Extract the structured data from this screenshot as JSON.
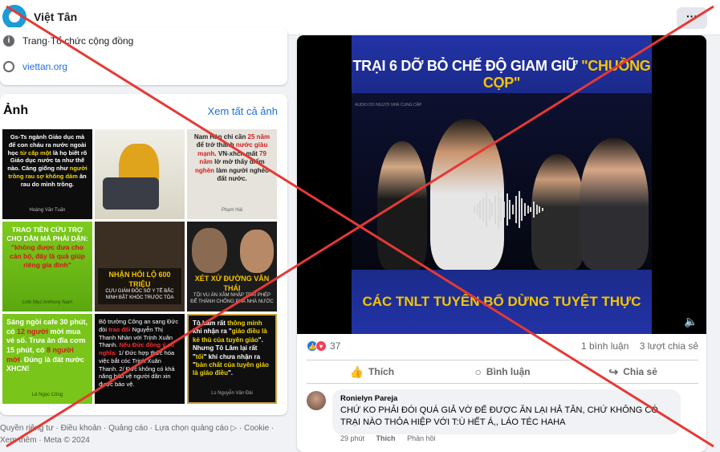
{
  "header": {
    "brand": "Việt Tân",
    "more_label": "···"
  },
  "intro": {
    "category_prefix": "Trang",
    "category_sep": " · ",
    "category": "Tổ chức cộng đồng",
    "website": "viettan.org",
    "info_icon": "info-icon",
    "globe_icon": "globe-icon"
  },
  "photos": {
    "title": "Ảnh",
    "see_all": "Xem tất cả ảnh",
    "tiles": {
      "t1": {
        "a": "Gs-Ts ngành Giáo dục mà để con cháu ra nước ngoài học ",
        "b": "từ cấp một",
        "c": " là họ biết rõ Giáo dục nước ta như thế nào. Càng giống như ",
        "d": "người trồng rau sợ không dám",
        "e": " ăn rau do mình trồng.",
        "sig": "Hoàng Văn Tuấn"
      },
      "t3": {
        "a": "Nam Hàn chỉ cần ",
        "b": "25 năm",
        "c": " để trở thành ",
        "d": "nước giàu mạnh",
        "e": ". VN-xhcn mất ",
        "f": "79 năm",
        " g": "",
        "h": " lờ mờ thấy điểm ",
        "i": "nghèn",
        "j": " làm người nghèo đất nước.",
        "sig": "Phạm Hải"
      },
      "t4": {
        "a": "TRAO TIỀN CỨU TRỢ CHO DÂN MÀ PHẢI DẶN: ",
        "b": "\"không được đưa cho cán bộ, đây là quà giúp riêng gia đình\"",
        "sig": "Linh Mục Anthony Nam"
      },
      "t5": {
        "a": "NHẬN HỐI LỘ 600 TRIỆU",
        "b": "CỰU GIÁM ĐỐC SỞ Y TẾ BẮC NINH BẬT KHÓC TRƯỚC TÒA"
      },
      "t6": {
        "a": "XÉT XỬ ĐƯỜNG VĂN THÁI",
        "b": "TỘI VU ÁN XÂM NHẬP TRÁI PHÉP ĐỂ THÀNH CHỐNG PHÁ NHÀ NƯỚC"
      },
      "t7": {
        "a": "Sáng ngồi cafe 30 phút, có ",
        "b": "12 người",
        "c": " mời mua vé số. Trưa ăn đĩa cơm 15 phút, có ",
        "d": "8 người mời",
        "e": ". Đúng là đất nước XHCN!",
        "sig": "Lê Ngọc Công"
      },
      "t8": {
        "a": "Bộ trưởng Công an sang Đức đòi ",
        "b": "trao đổi",
        "c": " Nguyễn Thị Thanh Nhàn với Trịnh Xuân Thanh. ",
        "d": "Nếu Đức đồng ý có nghĩa:",
        "e": " 1/ Đức hợp thức hóa việc bắt cóc Trịnh Xuân Thanh. 2/ Đức không có khả năng bảo vệ người dân xin được bảo vệ."
      },
      "t9": {
        "a": "Tô Lâm rất ",
        "b": "thông minh",
        "c": " khi nhận ra \"",
        "d": "giáo điều là kẻ thù của tuyên giáo",
        "e": "\". Nhưng Tô Lâm lại rất \"",
        "f": "tối",
        "g": "\" khi chưa nhận ra \"",
        "h": "bản chất của tuyên giáo là giáo điều",
        "i": "\".",
        "sig": "Ls Nguyễn Văn Đài"
      }
    }
  },
  "footer": {
    "text": "Quyền riêng tư · Điều khoản · Quảng cáo · Lựa chọn quảng cáo ▷ · Cookie · Xem thêm · Meta © 2024"
  },
  "post": {
    "video": {
      "headline_a": "TRẠI 6 DỠ BỎ CHẾ ĐỘ GIAM GIỮ ",
      "headline_b": "\"CHUỒNG CỌP\"",
      "credit": "AUDIO DO NGƯỜI NHÀ CUNG CẤP",
      "footer": "CÁC TNLT TUYÊN BỐ DỪNG TUYỆT THỰC",
      "volume_icon": "volume-icon"
    },
    "reactions": {
      "count": "37",
      "like_icon": "like-icon",
      "love_icon": "love-icon"
    },
    "comments_count": "1 bình luận",
    "shares_count": "3 lượt chia sẻ",
    "actions": {
      "like": "Thích",
      "comment": "Bình luận",
      "share": "Chia sẻ"
    },
    "comment": {
      "author": "Ronielyn Pareja",
      "text": "CHỨ KO PHẢI ĐÓI QUÁ GIẢ VỜ ĐỂ ĐƯỢC ĂN LẠI HẢ TÂN, CHỨ KHÔNG CÓ TRẠI NÀO THỎA HIỆP VỚI T:Ù HẾT Á,, LÁO TÉC HAHA",
      "time": "29 phút",
      "like": "Thích",
      "reply": "Phản hồi"
    }
  },
  "colors": {
    "accent": "#1877f2",
    "link": "#216fdb",
    "cross": "#e53935",
    "video_blue": "#1e2a8c",
    "headline_yellow": "#f5c400"
  }
}
